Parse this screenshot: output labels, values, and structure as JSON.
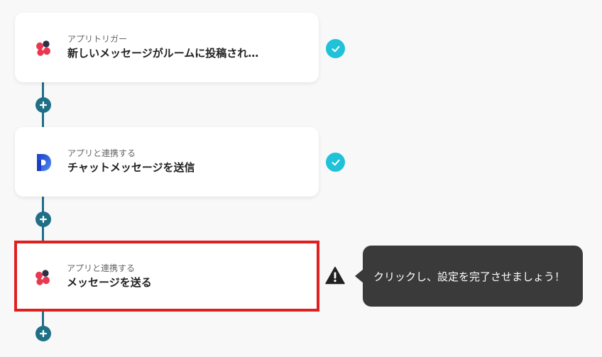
{
  "flow": {
    "steps": [
      {
        "subtitle": "アプリトリガー",
        "title": "新しいメッセージがルームに投稿され…",
        "app_icon": "chatwork-flower-icon",
        "status": "complete"
      },
      {
        "subtitle": "アプリと連携する",
        "title": "チャットメッセージを送信",
        "app_icon": "blue-d-logo-icon",
        "status": "complete"
      },
      {
        "subtitle": "アプリと連携する",
        "title": "メッセージを送る",
        "app_icon": "chatwork-flower-icon",
        "status": "warning"
      }
    ],
    "add_step_icon": "plus-icon"
  },
  "tooltip": {
    "text": "クリックし、設定を完了させましょう！"
  },
  "colors": {
    "connector": "#1f6f86",
    "check": "#1fc2d8",
    "selected_border": "#e02020",
    "tooltip_bg": "#3a3a3a"
  }
}
